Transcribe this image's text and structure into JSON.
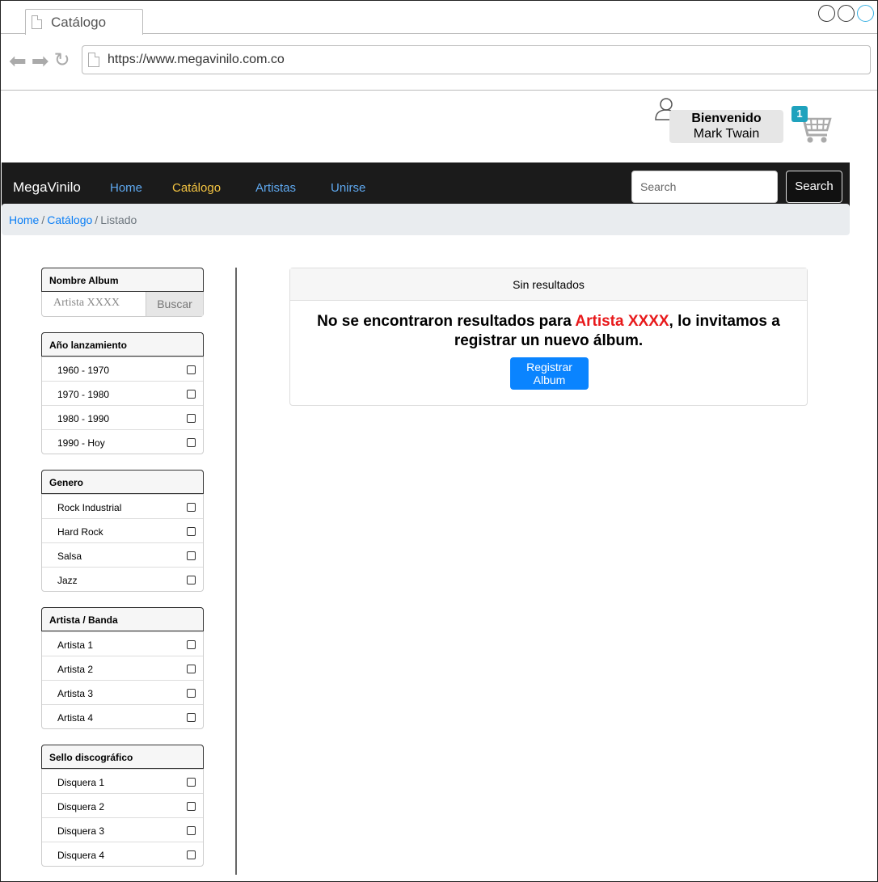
{
  "browser": {
    "tab_title": "Catálogo",
    "url": "https://www.megavinilo.com.co"
  },
  "user": {
    "welcome": "Bienvenido",
    "name": "Mark Twain",
    "cart_count": "1"
  },
  "navbar": {
    "brand": "MegaVinilo",
    "links": [
      "Home",
      "Catálogo",
      "Artistas",
      "Unirse"
    ],
    "active": "Catálogo",
    "search_placeholder": "Search",
    "search_button": "Search"
  },
  "breadcrumb": {
    "home": "Home",
    "catalog": "Catálogo",
    "current": "Listado"
  },
  "filters": {
    "name": {
      "title": "Nombre Album",
      "value": "Artista XXXX",
      "button": "Buscar"
    },
    "year": {
      "title": "Año lanzamiento",
      "options": [
        "1960 - 1970",
        "1970 - 1980",
        "1980 - 1990",
        "1990 - Hoy"
      ]
    },
    "genre": {
      "title": "Genero",
      "options": [
        "Rock Industrial",
        "Hard Rock",
        "Salsa",
        "Jazz"
      ]
    },
    "artist": {
      "title": "Artista / Banda",
      "options": [
        "Artista 1",
        "Artista 2",
        "Artista 3",
        "Artista 4"
      ]
    },
    "label": {
      "title": "Sello discográfico",
      "options": [
        "Disquera 1",
        "Disquera 2",
        "Disquera 3",
        "Disquera 4"
      ]
    }
  },
  "result": {
    "header": "Sin resultados",
    "msg_before": "No se encontraron resultados para ",
    "msg_highlight": "Artista XXXX",
    "msg_after": ", lo invitamos a registrar un nuevo álbum.",
    "button": "Registrar Album"
  },
  "colors": {
    "navbar_bg": "#1b1b1b",
    "nav_link": "#5fa9f0",
    "nav_active": "#f5c542",
    "highlight": "#e8191b",
    "primary_button": "#0a84ff",
    "cart_badge": "#1fa2bd"
  }
}
